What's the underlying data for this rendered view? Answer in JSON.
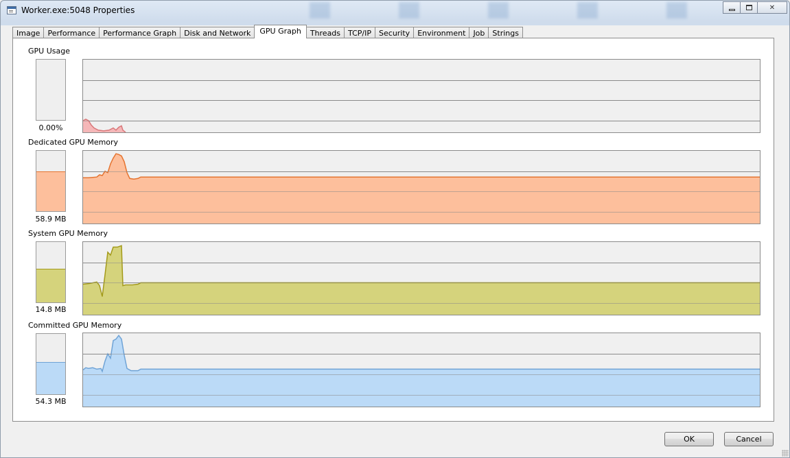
{
  "window": {
    "title": "Worker.exe:5048 Properties",
    "accent": "#cfdcec"
  },
  "tabs": [
    {
      "label": "Image"
    },
    {
      "label": "Performance"
    },
    {
      "label": "Performance Graph"
    },
    {
      "label": "Disk and Network"
    },
    {
      "label": "GPU Graph",
      "active": true
    },
    {
      "label": "Threads"
    },
    {
      "label": "TCP/IP"
    },
    {
      "label": "Security"
    },
    {
      "label": "Environment"
    },
    {
      "label": "Job"
    },
    {
      "label": "Strings"
    }
  ],
  "sections": [
    {
      "label": "GPU Usage",
      "value_text": "0.00%",
      "meter_fraction": 0.0,
      "stroke": "#d9787a",
      "fill": "#f5b7b8"
    },
    {
      "label": "Dedicated GPU Memory",
      "value_text": "58.9 MB",
      "meter_fraction": 0.65,
      "stroke": "#e5732f",
      "fill": "#fdbf9c"
    },
    {
      "label": "System GPU Memory",
      "value_text": "14.8 MB",
      "meter_fraction": 0.55,
      "stroke": "#a39a1a",
      "fill": "#d5d37c"
    },
    {
      "label": "Committed GPU Memory",
      "value_text": "54.3 MB",
      "meter_fraction": 0.52,
      "stroke": "#6fa3d6",
      "fill": "#bbdaf7"
    }
  ],
  "buttons": {
    "ok": "OK",
    "cancel": "Cancel"
  }
}
